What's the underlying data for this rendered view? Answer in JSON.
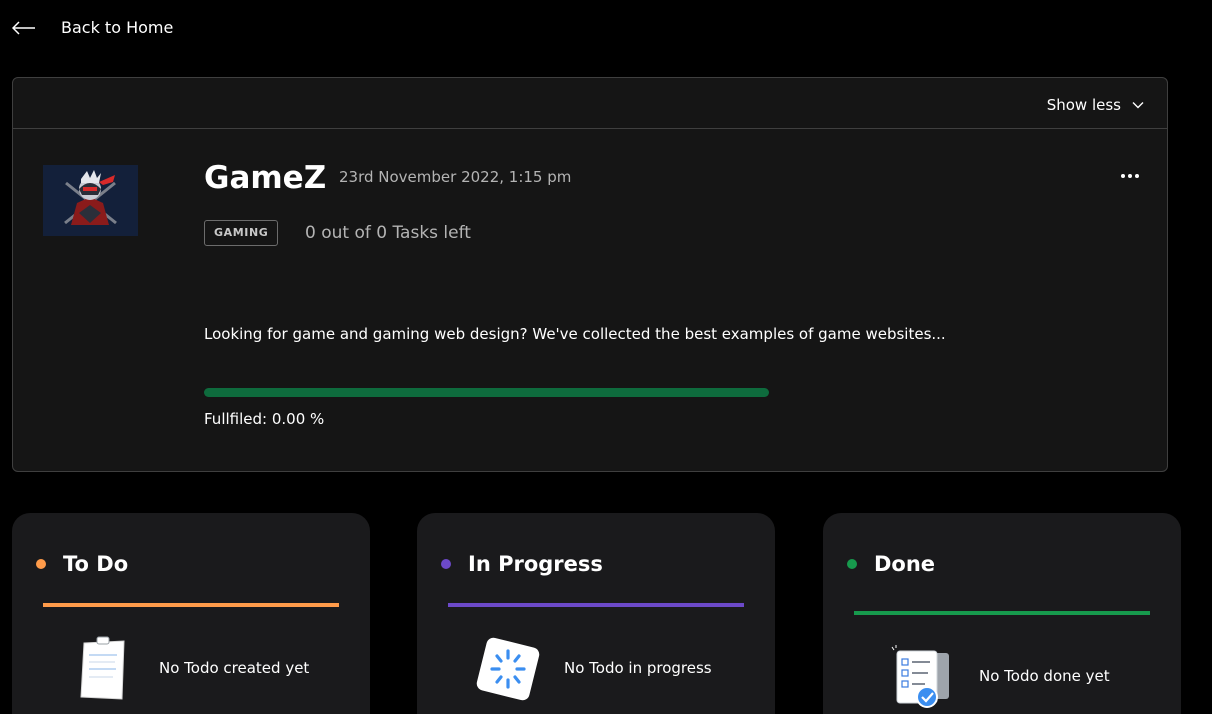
{
  "nav": {
    "back_label": "Back to Home"
  },
  "card": {
    "toggle_label": "Show less",
    "title": "GameZ",
    "date": "23rd November 2022, 1:15 pm",
    "tag": "GAMING",
    "tasks_left": "0 out of 0 Tasks left",
    "description": "Looking for game and gaming web design? We've collected the best examples of game websites...",
    "progress_percent": 0,
    "fulfilled_label": "Fullfiled: 0.00 %"
  },
  "columns": [
    {
      "title": "To Do",
      "empty_text": "No Todo created yet",
      "color": "#ff9b4a"
    },
    {
      "title": "In Progress",
      "empty_text": "No Todo in progress",
      "color": "#6c49c9"
    },
    {
      "title": "Done",
      "empty_text": "No Todo done yet",
      "color": "#179a4d"
    }
  ],
  "icons": {
    "back": "arrow-left-icon",
    "toggle": "chevron-down-icon",
    "menu": "more-dots-icon",
    "todo": "clipboard-icon",
    "progress": "loading-spinner-icon",
    "done": "checklist-icon"
  }
}
